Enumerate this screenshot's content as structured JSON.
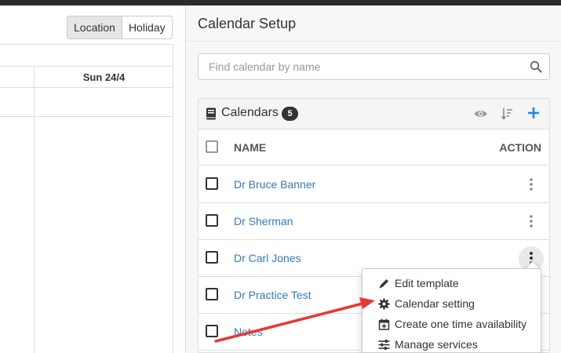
{
  "left": {
    "toggle": [
      "Location",
      "Holiday"
    ],
    "day_header": "Sun 24/4"
  },
  "setup": {
    "title": "Calendar Setup",
    "search_placeholder": "Find calendar by name",
    "search_value": ""
  },
  "panel": {
    "title": "Calendars",
    "count": "5",
    "col_name": "NAME",
    "col_action": "ACTION",
    "rows": [
      {
        "name": "Dr Bruce Banner"
      },
      {
        "name": "Dr Sherman"
      },
      {
        "name": "Dr Carl Jones"
      },
      {
        "name": "Dr Practice Test"
      },
      {
        "name": "Notes"
      }
    ]
  },
  "menu": {
    "items": [
      {
        "label": "Edit template",
        "icon": "pencil-icon"
      },
      {
        "label": "Calendar setting",
        "icon": "gear-icon"
      },
      {
        "label": "Create one time availability",
        "icon": "calendar-plus-icon"
      },
      {
        "label": "Manage services",
        "icon": "sliders-icon"
      }
    ]
  },
  "colors": {
    "link": "#337ab7",
    "accent": "#1e88e5",
    "annotation_arrow": "#e53935"
  }
}
